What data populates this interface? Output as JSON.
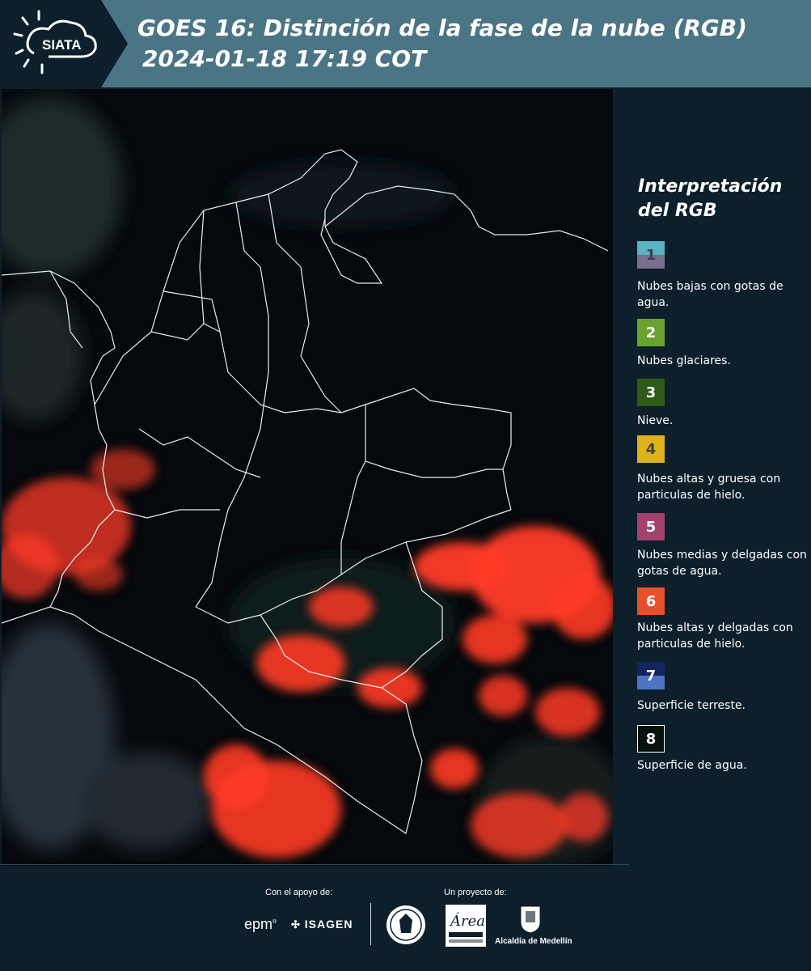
{
  "header": {
    "brand": "SIATA",
    "title_line1": "GOES 16: Distinción de la fase de la nube (RGB)",
    "title_line2": "2024-01-18 17:19 COT"
  },
  "legend": {
    "title": "Interpretación del RGB",
    "items": [
      {
        "number": "1",
        "label": "Nubes bajas con gotas de agua.",
        "colors": [
          "#5ab3c3",
          "#7a6f8f"
        ],
        "number_color": "#3c3f4f"
      },
      {
        "number": "2",
        "label": "Nubes glaciares.",
        "colors": [
          "#6aa22f"
        ],
        "number_color": "#ffffff"
      },
      {
        "number": "3",
        "label": "Nieve.",
        "colors": [
          "#2f5a1a"
        ],
        "number_color": "#ffffff"
      },
      {
        "number": "4",
        "label": "Nubes altas y gruesa con particulas de hielo.",
        "colors": [
          "#ddb21a"
        ],
        "number_color": "#3c3f4f"
      },
      {
        "number": "5",
        "label": "Nubes medias y delgadas con gotas de agua.",
        "colors": [
          "#a3436d"
        ],
        "number_color": "#ffffff"
      },
      {
        "number": "6",
        "label": "Nubes altas y delgadas con particulas de hielo.",
        "colors": [
          "#e8502b"
        ],
        "number_color": "#ffffff"
      },
      {
        "number": "7",
        "label": "Superficie terreste.",
        "colors": [
          "#14245e",
          "#4f74c7"
        ],
        "number_color": "#ffffff"
      },
      {
        "number": "8",
        "label": "Superficie de agua.",
        "colors": [
          "#06110b"
        ],
        "number_color": "#ffffff"
      }
    ]
  },
  "footer": {
    "support_label": "Con el apoyo de:",
    "project_label": "Un proyecto de:",
    "sponsors": [
      "epm",
      "ISAGEN"
    ],
    "partners": [
      "Área Metropolitana Valle de Aburrá",
      "Alcaldía de Medellín"
    ],
    "alcaldia_label": "Alcaldía de Medellín",
    "epm": "epm",
    "isagen": "ISAGEN"
  },
  "colors": {
    "header_bg": "#4a7585",
    "page_bg": "#0c1f2b",
    "cloud_ice": "#ff3b26"
  }
}
